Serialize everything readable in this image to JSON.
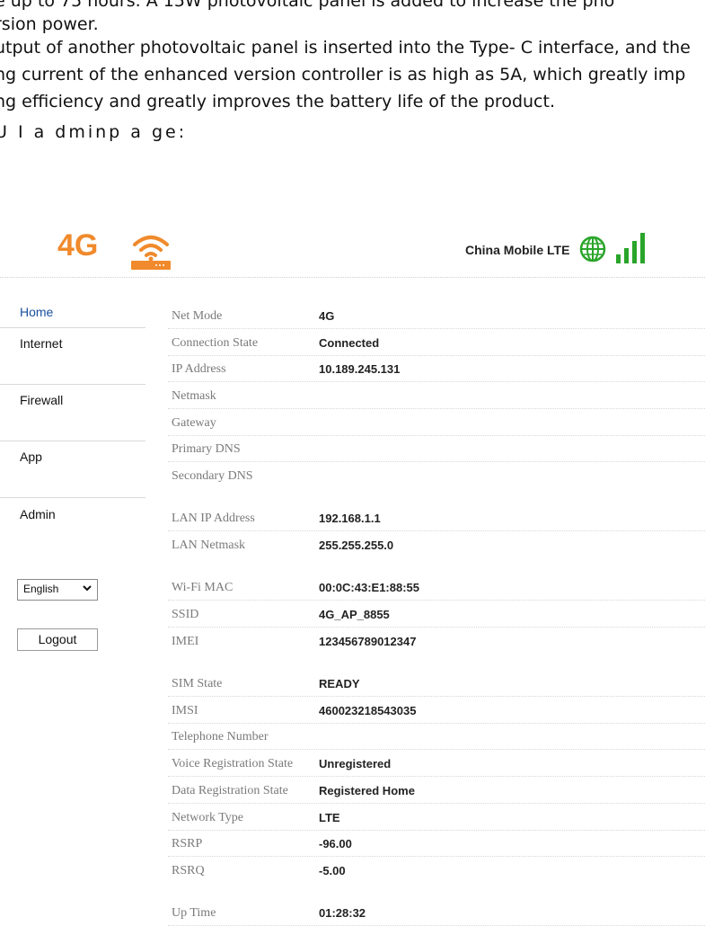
{
  "document": {
    "lines": [
      "e up to 75 hours. A 15W photovoltaic panel is added to increase the pho",
      "rsion power.",
      "utput of another photovoltaic panel is inserted into the Type- C interface, and the",
      "ng current of the enhanced version controller is as high as 5A, which greatly imp",
      "ng efficiency and greatly improves the battery life of the product.",
      "U I a dminp a ge:"
    ]
  },
  "header": {
    "logo_text": "4G",
    "logo_color": "#f08a2c",
    "router_icon": "wifi-router-icon",
    "operator_name": "China Mobile LTE",
    "globe_icon": "globe-icon",
    "globe_color": "#2aa52a",
    "signal_icon": "signal-bars-icon",
    "signal_color": "#2aa52a"
  },
  "sidebar": {
    "items": [
      {
        "label": "Home",
        "active": true
      },
      {
        "label": "Internet"
      },
      {
        "label": "Firewall"
      },
      {
        "label": "App"
      },
      {
        "label": "Admin"
      }
    ],
    "language": {
      "selected": "English"
    },
    "logout_label": "Logout",
    "accent_color": "#1a4fa0"
  },
  "status": {
    "rows": [
      {
        "label": "Net Mode",
        "value": "4G"
      },
      {
        "label": "Connection State",
        "value": "Connected"
      },
      {
        "label": "IP Address",
        "value": "10.189.245.131"
      },
      {
        "label": "Netmask",
        "value": ""
      },
      {
        "label": "Gateway",
        "value": ""
      },
      {
        "label": "Primary DNS",
        "value": ""
      },
      {
        "label": "Secondary DNS",
        "value": ""
      },
      {
        "label": "LAN IP Address",
        "value": "192.168.1.1"
      },
      {
        "label": "LAN Netmask",
        "value": "255.255.255.0"
      },
      {
        "label": "Wi-Fi MAC",
        "value": "00:0C:43:E1:88:55"
      },
      {
        "label": "SSID",
        "value": "4G_AP_8855"
      },
      {
        "label": "IMEI",
        "value": "123456789012347"
      },
      {
        "label": "SIM State",
        "value": "READY"
      },
      {
        "label": "IMSI",
        "value": "460023218543035"
      },
      {
        "label": "Telephone Number",
        "value": ""
      },
      {
        "label": "Voice Registration State",
        "value": "Unregistered"
      },
      {
        "label": "Data Registration State",
        "value": "Registered Home"
      },
      {
        "label": "Network Type",
        "value": "LTE"
      },
      {
        "label": "RSRP",
        "value": "-96.00"
      },
      {
        "label": "RSRQ",
        "value": "-5.00"
      },
      {
        "label": "Up Time",
        "value": "01:28:32"
      }
    ]
  }
}
